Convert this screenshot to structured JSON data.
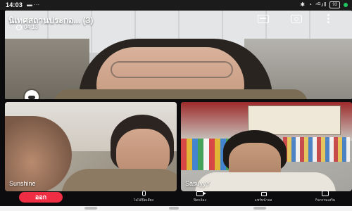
{
  "status_bar": {
    "time": "14:03",
    "notifications": "▬ ···",
    "signal_text": "⁴ᴳ.ıll",
    "battery": "93",
    "icons": [
      "bluetooth-icon",
      "wifi-icon",
      "signal-icon",
      "battery-icon",
      "recording-dot-icon"
    ]
  },
  "call": {
    "title": "นิเทศสถานประกอ... (3)",
    "elapsed": "04:13"
  },
  "participants": [
    {
      "name": "Sunshine"
    },
    {
      "name": "SasuyyY"
    }
  ],
  "controls": {
    "leave_label": "ออก",
    "mic_label": "ไม่ได้ปิดเสียง",
    "camera_label": "ปิดกล้อง",
    "share_label": "แชร์หน้าจอ",
    "extra_label": "กิจกรรมเสริม"
  },
  "colors": {
    "leave_button": "#ef2d43",
    "background": "#0c0c0e",
    "recording_dot": "#22c55e"
  }
}
